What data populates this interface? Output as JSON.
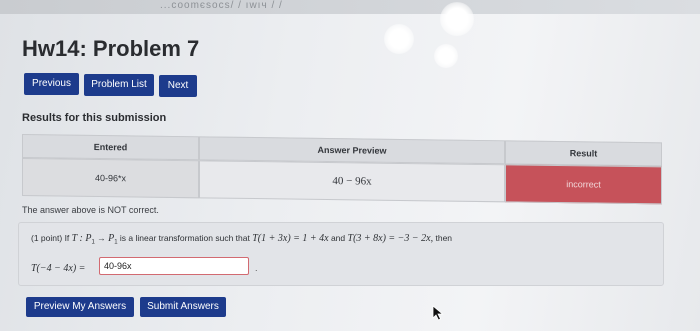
{
  "page": {
    "title": "Hw14: Problem 7",
    "top_url_fragment": "...сооmєsocs/ / ıwıч / /"
  },
  "nav": {
    "previous_label": "Previous",
    "problem_list_label": "Problem List",
    "next_label": "Next"
  },
  "results": {
    "heading": "Results for this submission",
    "columns": [
      "Entered",
      "Answer Preview",
      "Result"
    ],
    "row": {
      "entered": "40-96*x",
      "preview": "40 − 96x",
      "result": "incorrect"
    },
    "feedback": "The answer above is NOT correct."
  },
  "problem": {
    "points": "(1 point)",
    "intro": "If",
    "transform": "T : P",
    "arrow": "→",
    "codomain": "P",
    "description": "is a linear transformation such that",
    "eq1": "T(1 + 3x) = 1 + 4x",
    "and": "and",
    "eq2": "T(3 + 8x) = −3 − 2x,",
    "then": "then",
    "answer_label": "T(−4 − 4x) =",
    "answer_value": "40-96x",
    "answer_trail": "."
  },
  "actions": {
    "preview_label": "Preview My Answers",
    "submit_label": "Submit Answers"
  },
  "colors": {
    "button_blue": "#1d3b8c",
    "incorrect_red": "#c6525a"
  },
  "icons": {
    "cursor": "mouse-pointer-icon"
  }
}
